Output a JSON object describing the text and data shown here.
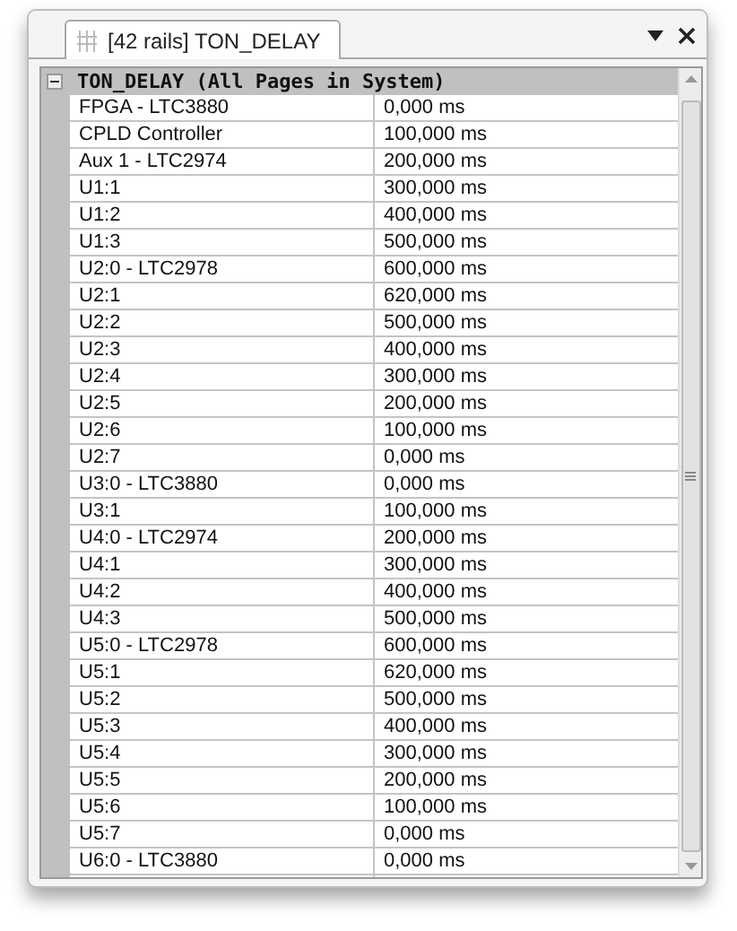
{
  "tab": {
    "label": "[42 rails] TON_DELAY",
    "selected": true
  },
  "group": {
    "title": "TON_DELAY (All Pages in System)",
    "expanded": true
  },
  "rows": [
    [
      "FPGA - LTC3880",
      "0,000 ms"
    ],
    [
      "CPLD Controller",
      "100,000 ms"
    ],
    [
      "Aux 1 - LTC2974",
      "200,000 ms"
    ],
    [
      "U1:1",
      "300,000 ms"
    ],
    [
      "U1:2",
      "400,000 ms"
    ],
    [
      "U1:3",
      "500,000 ms"
    ],
    [
      "U2:0 - LTC2978",
      "600,000 ms"
    ],
    [
      "U2:1",
      "620,000 ms"
    ],
    [
      "U2:2",
      "500,000 ms"
    ],
    [
      "U2:3",
      "400,000 ms"
    ],
    [
      "U2:4",
      "300,000 ms"
    ],
    [
      "U2:5",
      "200,000 ms"
    ],
    [
      "U2:6",
      "100,000 ms"
    ],
    [
      "U2:7",
      "0,000 ms"
    ],
    [
      "U3:0 - LTC3880",
      "0,000 ms"
    ],
    [
      "U3:1",
      "100,000 ms"
    ],
    [
      "U4:0 - LTC2974",
      "200,000 ms"
    ],
    [
      "U4:1",
      "300,000 ms"
    ],
    [
      "U4:2",
      "400,000 ms"
    ],
    [
      "U4:3",
      "500,000 ms"
    ],
    [
      "U5:0 - LTC2978",
      "600,000 ms"
    ],
    [
      "U5:1",
      "620,000 ms"
    ],
    [
      "U5:2",
      "500,000 ms"
    ],
    [
      "U5:3",
      "400,000 ms"
    ],
    [
      "U5:4",
      "300,000 ms"
    ],
    [
      "U5:5",
      "200,000 ms"
    ],
    [
      "U5:6",
      "100,000 ms"
    ],
    [
      "U5:7",
      "0,000 ms"
    ],
    [
      "U6:0 - LTC3880",
      "0,000 ms"
    ]
  ]
}
